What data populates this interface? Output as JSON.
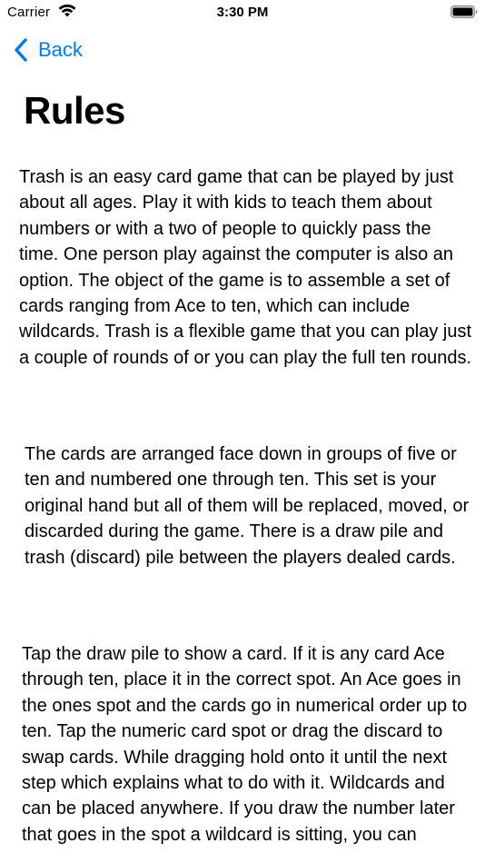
{
  "status_bar": {
    "carrier": "Carrier",
    "time": "3:30 PM",
    "wifi_icon": "wifi-icon",
    "battery_icon": "battery-icon"
  },
  "nav": {
    "back_label": "Back",
    "back_icon": "chevron-left-icon",
    "accent_color": "#007aff"
  },
  "page": {
    "title": "Rules",
    "paragraphs": [
      "Trash is an easy card game that can be played by just about all ages. Play it with kids to teach them about numbers or with a two of people to quickly pass the time. One person play against the computer is also an option.  The object of the game is to assemble a set of cards ranging from Ace to ten, which can include wildcards. Trash is a flexible game that you can play just a couple of rounds of or you can play the full ten rounds.",
      "The cards are arranged face down in groups of five or ten and numbered one through ten. This set is your original hand but all of them will be replaced, moved, or discarded during the game. There is a draw pile and trash (discard) pile between the players dealed cards.",
      "Tap the draw pile to show a card. If it is any card Ace through ten, place it in the correct spot. An Ace goes in the ones spot and the cards go in numerical order up to ten. Tap the numeric card spot or drag the discard to swap cards.  While dragging hold onto it until the next step which explains what to do with it.  Wildcards and can be placed anywhere. If you draw the number later that goes in the spot a wildcard is sitting, you can"
    ]
  }
}
